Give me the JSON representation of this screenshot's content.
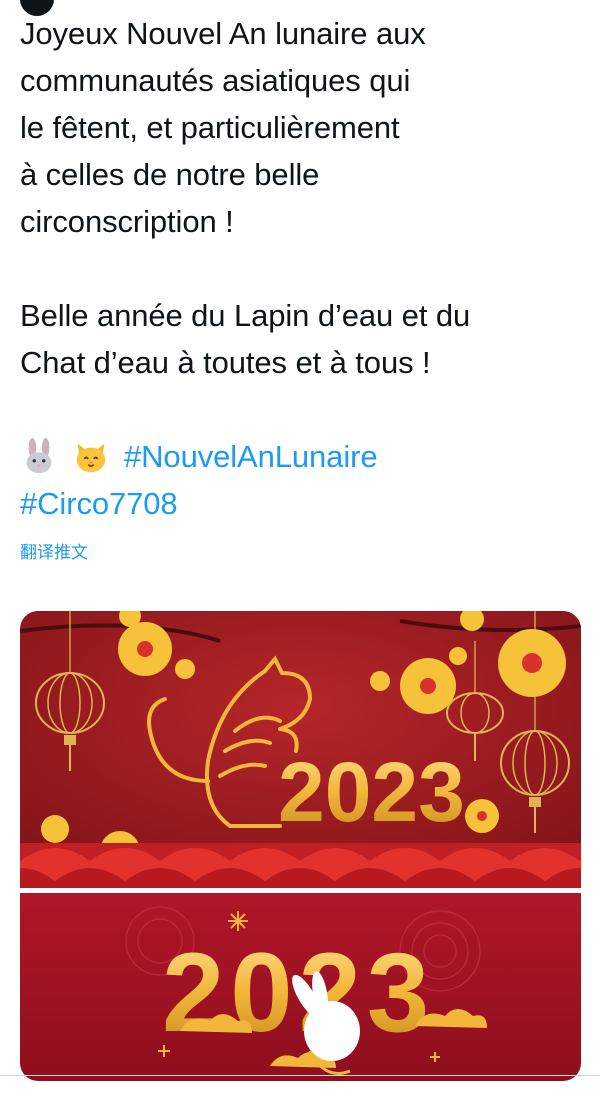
{
  "tweet": {
    "paragraph1": [
      "Joyeux Nouvel An lunaire aux",
      "communautés asiatiques qui",
      "le fêtent, et particulièrement",
      "à celles de notre belle",
      "circonscription !"
    ],
    "paragraph2": [
      "Belle année du Lapin d’eau et du",
      "Chat d’eau à toutes et à tous !"
    ],
    "emojis": [
      "rabbit-face-emoji",
      "cat-face-emoji"
    ],
    "hashtags": [
      "#NouvelAnLunaire",
      "#Circo7708"
    ]
  },
  "translate_label": "翻译推文",
  "media": {
    "top_year": "2023",
    "bottom_year": "2023",
    "colors": {
      "top_bg": "#9e1b1f",
      "bottom_bg": "#a8141f",
      "gold": "#f2b63a",
      "wave": "#d92b2b"
    }
  }
}
